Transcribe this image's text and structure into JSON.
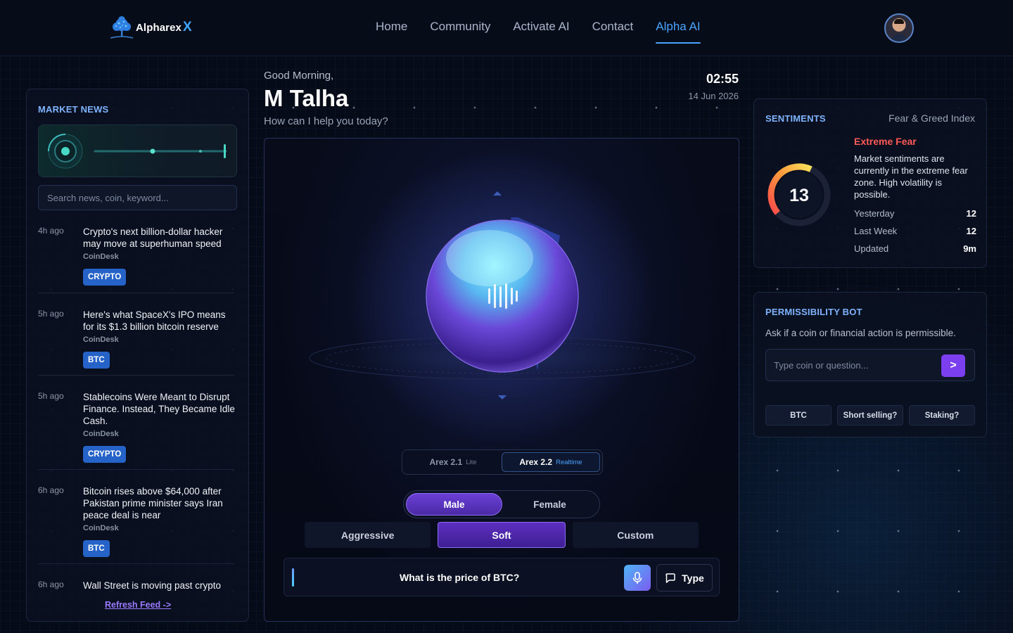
{
  "brand": {
    "name": "Alpharex",
    "mark": "X"
  },
  "nav": {
    "items": [
      {
        "label": "Home"
      },
      {
        "label": "Community"
      },
      {
        "label": "Activate AI"
      },
      {
        "label": "Contact"
      },
      {
        "label": "Alpha AI",
        "active": true
      }
    ]
  },
  "news": {
    "title": "MARKET NEWS",
    "search_placeholder": "Search news, coin, keyword...",
    "items": [
      {
        "ago": "4h ago",
        "headline": "Crypto's next billion-dollar hacker may move at superhuman speed",
        "source": "CoinDesk",
        "tag": "CRYPTO"
      },
      {
        "ago": "5h ago",
        "headline": "Here's what SpaceX's IPO means for its $1.3 billion bitcoin reserve",
        "source": "CoinDesk",
        "tag": "BTC"
      },
      {
        "ago": "5h ago",
        "headline": "Stablecoins Were Meant to Disrupt Finance. Instead, They Became Idle Cash.",
        "source": "CoinDesk",
        "tag": "CRYPTO"
      },
      {
        "ago": "6h ago",
        "headline": "Bitcoin rises above $64,000 after Pakistan prime minister says Iran peace deal is near",
        "source": "CoinDesk",
        "tag": "BTC"
      },
      {
        "ago": "6h ago",
        "headline": "Wall Street is moving past crypto"
      }
    ],
    "refresh_label": "Refresh Feed ->"
  },
  "assistant": {
    "greeting": "Good Morning,",
    "user_name": "M Talha",
    "prompt": "How can I help you today?",
    "time": "02:55",
    "date": "14 Jun 2026",
    "models": [
      {
        "name": "Arex 2.1",
        "tier": "Lite",
        "selected": false
      },
      {
        "name": "Arex 2.2",
        "tier": "Realtime",
        "selected": true
      }
    ],
    "voices": [
      {
        "label": "Male",
        "selected": true
      },
      {
        "label": "Female",
        "selected": false
      }
    ],
    "modes": [
      {
        "label": "Aggressive",
        "selected": false
      },
      {
        "label": "Soft",
        "selected": true
      },
      {
        "label": "Custom",
        "selected": false
      }
    ],
    "query": "What is the price of BTC?",
    "type_label": "Type",
    "icons": {
      "mic": "microphone-icon",
      "type": "chat-bubble-icon"
    }
  },
  "sentiments": {
    "title": "SENTIMENTS",
    "index_label": "Fear & Greed Index",
    "value": "13",
    "gauge_value": 13,
    "level": "Extreme Fear",
    "description": "Market sentiments are currently in the extreme fear zone. High volatility is possible.",
    "stats": [
      {
        "label": "Yesterday",
        "value": "12"
      },
      {
        "label": "Last Week",
        "value": "12"
      },
      {
        "label": "Updated",
        "value": "9m"
      }
    ],
    "colors": {
      "fear": "#ff5a57",
      "accent": "#f5c542"
    }
  },
  "permissibility": {
    "title": "PERMISSIBILITY BOT",
    "subtitle": "Ask if a coin or financial action is permissible.",
    "input_placeholder": "Type coin or question...",
    "submit_label": ">",
    "chips": [
      "BTC",
      "Short selling?",
      "Staking?"
    ]
  },
  "colors": {
    "accent": "#4aa3ff",
    "primary_purple": "#7b3ff0",
    "tag_blue": "#2563c9"
  }
}
